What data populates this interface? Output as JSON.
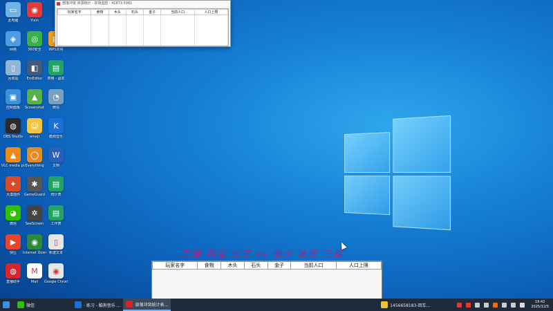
{
  "desktop_icons": [
    {
      "label": "此电脑",
      "color": "#6fb2e6",
      "glyph": "▭",
      "col": 0,
      "row": 0
    },
    {
      "label": "Yixin",
      "color": "#e23b3b",
      "glyph": "◉",
      "col": 1,
      "row": 0
    },
    {
      "label": "网络",
      "color": "#4d9be0",
      "glyph": "◈",
      "col": 0,
      "row": 1
    },
    {
      "label": "360安全",
      "color": "#3bb14a",
      "glyph": "◎",
      "col": 1,
      "row": 1
    },
    {
      "label": "WPS表格",
      "color": "#f0a020",
      "glyph": "▦",
      "col": 2,
      "row": 1
    },
    {
      "label": "回收站",
      "color": "#8fb6d6",
      "glyph": "▯",
      "col": 0,
      "row": 2
    },
    {
      "label": "EmEditor",
      "color": "#455a7a",
      "glyph": "◧",
      "col": 1,
      "row": 2
    },
    {
      "label": "表格 - 副本",
      "color": "#21a366",
      "glyph": "▤",
      "col": 2,
      "row": 2
    },
    {
      "label": "控制面板",
      "color": "#3d8fd6",
      "glyph": "▣",
      "col": 0,
      "row": 3
    },
    {
      "label": "Screenshot",
      "color": "#5ab04a",
      "glyph": "▲",
      "col": 1,
      "row": 3
    },
    {
      "label": "微信",
      "color": "#7aa0c0",
      "glyph": "◔",
      "col": 2,
      "row": 3
    },
    {
      "label": "OBS Studio",
      "color": "#2a2a2a",
      "glyph": "◍",
      "col": 0,
      "row": 4
    },
    {
      "label": "emoji",
      "color": "#f5c542",
      "glyph": "☺",
      "col": 1,
      "row": 4
    },
    {
      "label": "酷狗音乐",
      "color": "#1a6fd8",
      "glyph": "K",
      "col": 2,
      "row": 4
    },
    {
      "label": "VLC media player",
      "color": "#f08a1c",
      "glyph": "▲",
      "col": 0,
      "row": 5
    },
    {
      "label": "Everything",
      "color": "#e58b24",
      "glyph": "◯",
      "col": 1,
      "row": 5
    },
    {
      "label": "文档",
      "color": "#2b5fbd",
      "glyph": "W",
      "col": 2,
      "row": 5
    },
    {
      "label": "大漠插件",
      "color": "#d64b2a",
      "glyph": "✦",
      "col": 0,
      "row": 6
    },
    {
      "label": "GameGuard",
      "color": "#555",
      "glyph": "✱",
      "col": 1,
      "row": 6
    },
    {
      "label": "统计表",
      "color": "#21a366",
      "glyph": "▤",
      "col": 2,
      "row": 6
    },
    {
      "label": "微信",
      "color": "#2dc100",
      "glyph": "◕",
      "col": 0,
      "row": 7
    },
    {
      "label": "SeeScreen",
      "color": "#444",
      "glyph": "✲",
      "col": 1,
      "row": 7
    },
    {
      "label": "工作表",
      "color": "#21a366",
      "glyph": "▤",
      "col": 2,
      "row": 7
    },
    {
      "label": "快压",
      "color": "#e8452c",
      "glyph": "▶",
      "col": 0,
      "row": 8
    },
    {
      "label": "Internet Download",
      "color": "#2c8a3a",
      "glyph": "◉",
      "col": 1,
      "row": 8
    },
    {
      "label": "新建文本",
      "color": "#e6e6e6",
      "glyph": "▯",
      "col": 2,
      "row": 8
    },
    {
      "label": "直播助手",
      "color": "#d4262d",
      "glyph": "◍",
      "col": 0,
      "row": 9
    },
    {
      "label": "Mail",
      "color": "#ffffff",
      "glyph": "M",
      "col": 1,
      "row": 9
    },
    {
      "label": "Google Chrome",
      "color": "#e6e6e6",
      "glyph": "◉",
      "col": 2,
      "row": 9
    }
  ],
  "small_window": {
    "title": "部落冲突 资源统计 · 农场监控 · 41873 5981"
  },
  "table_headers": [
    "玩家名字",
    "食物",
    "木头",
    "石头",
    "金子",
    "当前人口",
    "人口上限"
  ],
  "caption": "黑骑 四宝 公子 vs 美夕 冰芥 三叔",
  "taskbar": {
    "items": [
      {
        "label": "",
        "color": "#3b8eea"
      },
      {
        "label": "微信",
        "color": "#2dc100"
      },
      {
        "label": "· 练习 - 酷狗音乐 ...",
        "color": "#1a6fd8"
      },
      {
        "label": "部落冲突统计表...",
        "color": "#d4262d"
      }
    ],
    "tray_item": "1456658183-回车..."
  },
  "clock": {
    "time": "19:42",
    "date": "2025/12/5"
  },
  "colors": {
    "accent": "#b01c84",
    "taskbar": "#1f2b3a"
  }
}
